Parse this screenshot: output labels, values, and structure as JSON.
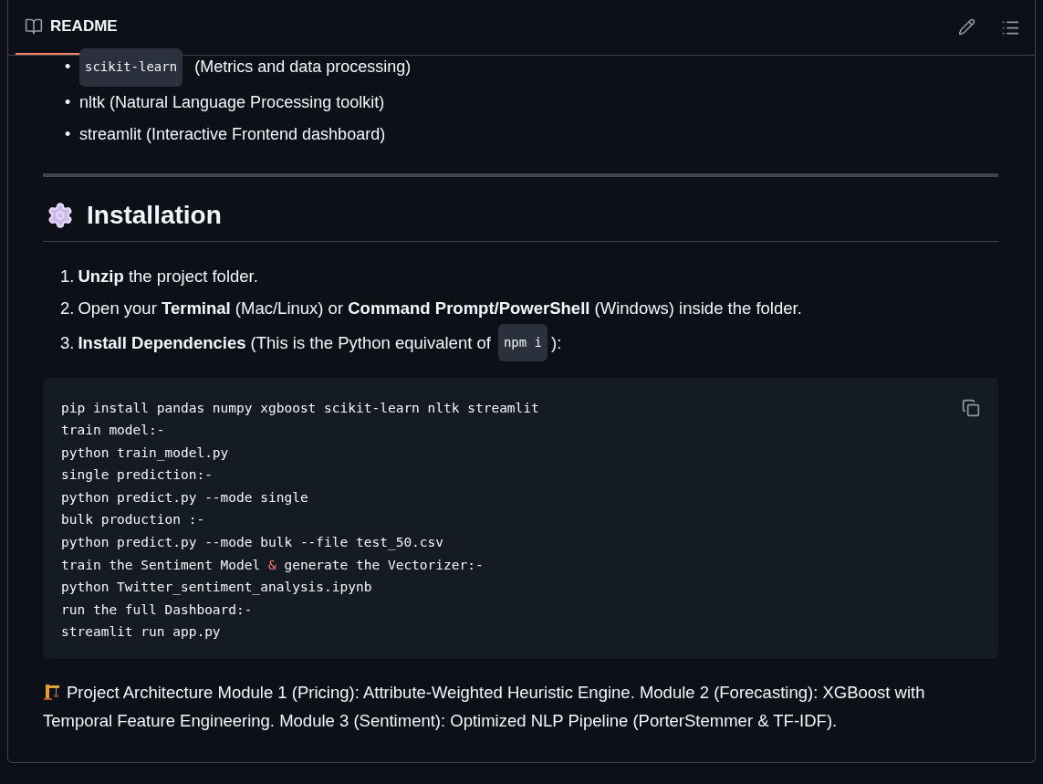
{
  "header": {
    "title": "README",
    "tab_selected": true
  },
  "bullets": [
    {
      "marker": "•",
      "code": "scikit-learn",
      "text": "(Metrics and data processing)"
    },
    {
      "marker": "•",
      "text": "nltk (Natural Language Processing toolkit)"
    },
    {
      "marker": "•",
      "text": "streamlit (Interactive Frontend dashboard)"
    }
  ],
  "section": {
    "title": "Installation"
  },
  "steps": [
    {
      "number": "1.",
      "text": "**Unzip** the project folder."
    },
    {
      "number": "2.",
      "text": "Open your **Terminal** (Mac/Linux) or **Command Prompt/PowerShell** (Windows) inside the folder."
    },
    {
      "number": "3.",
      "text": "**Install Dependencies** (This is the Python equivalent of",
      "code": "npm i",
      "after": "):"
    }
  ],
  "code_block": {
    "lines": [
      [
        {
          "kind": "plain",
          "text": "pip install pandas numpy xgboost scikit-learn nltk streamlit"
        }
      ],
      [
        {
          "kind": "plain",
          "text": "train model:-"
        }
      ],
      [
        {
          "kind": "plain",
          "text": "python train_model.py"
        }
      ],
      [
        {
          "kind": "plain",
          "text": "single prediction:-"
        }
      ],
      [
        {
          "kind": "plain",
          "text": "python predict.py --mode single"
        }
      ],
      [
        {
          "kind": "plain",
          "text": "bulk production :-"
        }
      ],
      [
        {
          "kind": "plain",
          "text": "python predict.py --mode bulk --file test_50.csv"
        }
      ],
      [
        {
          "kind": "plain",
          "text": "train the Sentiment Model "
        },
        {
          "kind": "entity",
          "text": "&"
        },
        {
          "kind": "plain",
          "text": " generate the Vectorizer:-"
        }
      ],
      [
        {
          "kind": "plain",
          "text": "python Twitter_sentiment_analysis.ipynb"
        }
      ],
      [
        {
          "kind": "plain",
          "text": "run the full Dashboard:-"
        }
      ],
      [
        {
          "kind": "plain",
          "text": "streamlit run app.py"
        }
      ]
    ]
  },
  "architecture": {
    "text": "Project Architecture Module 1 (Pricing): Attribute-Weighted Heuristic Engine. Module 2 (Forecasting): XGBoost with Temporal Feature Engineering. Module 3 (Sentiment): Optimized NLP Pipeline (PorterStemmer & TF-IDF)."
  }
}
